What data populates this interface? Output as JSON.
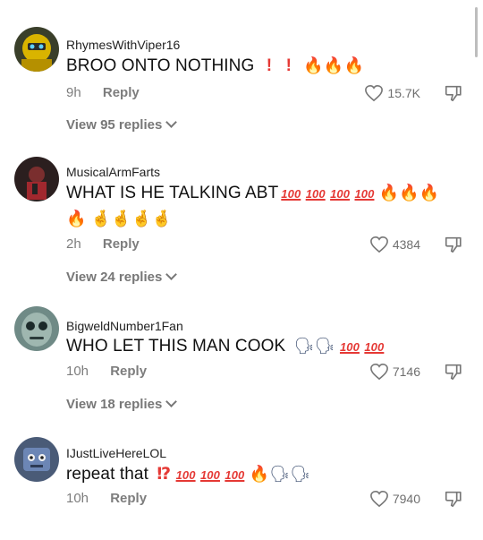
{
  "comments": [
    {
      "username": "RhymesWithViper16",
      "text": "BROO ONTO NOTHING",
      "time": "9h",
      "reply_label": "Reply",
      "likes": "15.7K",
      "view_replies": "View 95 replies",
      "avatar_icon": "robot-avatar-icon"
    },
    {
      "username": "MusicalArmFarts",
      "text": "WHAT IS HE TALKING ABT",
      "time": "2h",
      "reply_label": "Reply",
      "likes": "4384",
      "view_replies": "View 24 replies",
      "avatar_icon": "character-avatar-icon"
    },
    {
      "username": "BigweldNumber1Fan",
      "text": "WHO LET THIS MAN COOK",
      "time": "10h",
      "reply_label": "Reply",
      "likes": "7146",
      "view_replies": "View 18 replies",
      "avatar_icon": "robot-face-avatar-icon"
    },
    {
      "username": "IJustLiveHereLOL",
      "text": "repeat that",
      "time": "10h",
      "reply_label": "Reply",
      "likes": "7940",
      "avatar_icon": "blue-robot-avatar-icon"
    }
  ],
  "emoji": {
    "fire": "🔥",
    "exclaim": "❗",
    "hundred": "100",
    "fingers_crossed": "🤞",
    "speaking": "🗣",
    "interrobang": "⁉"
  },
  "colors": {
    "text": "#111111",
    "meta": "#7d7d7d",
    "accent_red": "#e53935"
  }
}
